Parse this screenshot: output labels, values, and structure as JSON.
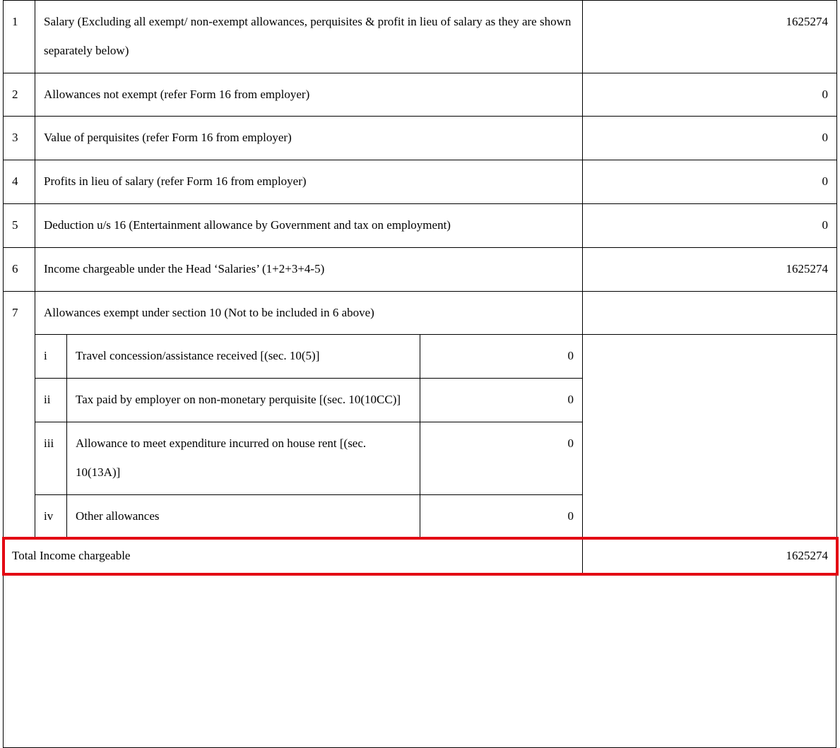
{
  "rows": {
    "r1": {
      "num": "1",
      "desc": "Salary (Excluding all exempt/ non-exempt allowances, perquisites & profit in lieu of salary as they are shown separately below)",
      "value": "1625274"
    },
    "r2": {
      "num": "2",
      "desc": "Allowances not exempt (refer Form 16 from employer)",
      "value": "0"
    },
    "r3": {
      "num": "3",
      "desc": "Value of perquisites (refer Form 16 from employer)",
      "value": "0"
    },
    "r4": {
      "num": "4",
      "desc": "Profits in lieu of salary (refer Form 16 from employer)",
      "value": "0"
    },
    "r5": {
      "num": "5",
      "desc": "Deduction u/s 16 (Entertainment allowance by Government and tax on employment)",
      "value": "0"
    },
    "r6": {
      "num": "6",
      "desc": "Income chargeable under the Head ‘Salaries’ (1+2+3+4-5)",
      "value": "1625274"
    },
    "r7": {
      "num": "7",
      "desc": "Allowances exempt under section 10 (Not to be included in 6 above)"
    },
    "r7i": {
      "sub": "i",
      "desc": "Travel concession/assistance received [(sec. 10(5)]",
      "value": "0"
    },
    "r7ii": {
      "sub": "ii",
      "desc": "Tax paid by employer on non-monetary perquisite [(sec. 10(10CC)]",
      "value": "0"
    },
    "r7iii": {
      "sub": "iii",
      "desc": "Allowance to meet expenditure incurred on house rent [(sec. 10(13A)]",
      "value": "0"
    },
    "r7iv": {
      "sub": "iv",
      "desc": "Other allowances",
      "value": "0"
    }
  },
  "total": {
    "label": "Total Income chargeable",
    "value": "1625274"
  }
}
